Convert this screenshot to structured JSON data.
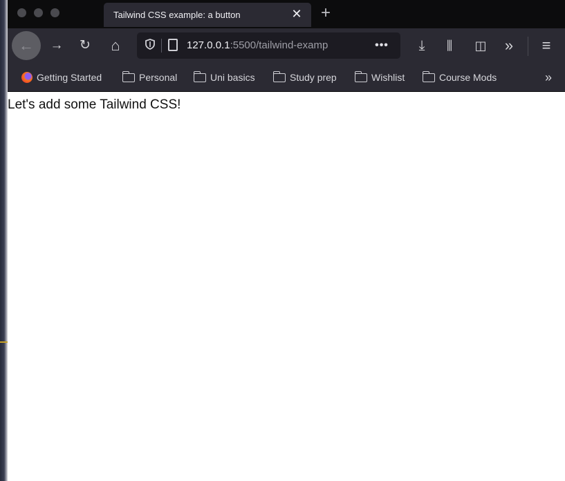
{
  "browser": {
    "tab": {
      "title": "Tailwind CSS example: a button",
      "close_glyph": "✕"
    },
    "new_tab_glyph": "+",
    "nav": {
      "back_icon": "arrow-left-icon",
      "forward_icon": "arrow-right-icon",
      "reload_icon": "reload-icon",
      "home_icon": "home-icon",
      "back_glyph": "←",
      "forward_glyph": "→",
      "reload_glyph": "↻",
      "home_glyph": "⌂"
    },
    "url": {
      "host": "127.0.0.1",
      "rest": ":5500/tailwind-examp",
      "more_glyph": "•••"
    },
    "toolbar": {
      "download_glyph": "⤓",
      "library_glyph": "⫼",
      "sidebar_glyph": "◫",
      "overflow_glyph": "»",
      "menu_glyph": "≡"
    },
    "bookmarks": [
      {
        "label": "Getting Started",
        "icon": "firefox-icon"
      },
      {
        "label": "Personal",
        "icon": "folder-icon"
      },
      {
        "label": "Uni basics",
        "icon": "folder-icon"
      },
      {
        "label": "Study prep",
        "icon": "folder-icon"
      },
      {
        "label": "Wishlist",
        "icon": "folder-icon"
      },
      {
        "label": "Course Mods",
        "icon": "folder-icon"
      }
    ],
    "bookmarks_overflow_glyph": "»"
  },
  "page": {
    "text": "Let's add some Tailwind CSS!"
  },
  "colors": {
    "tab_strip": "#0c0c0d",
    "toolbar": "#2b2a33",
    "urlbar": "#1c1b22",
    "page_background": "#ffffff"
  }
}
